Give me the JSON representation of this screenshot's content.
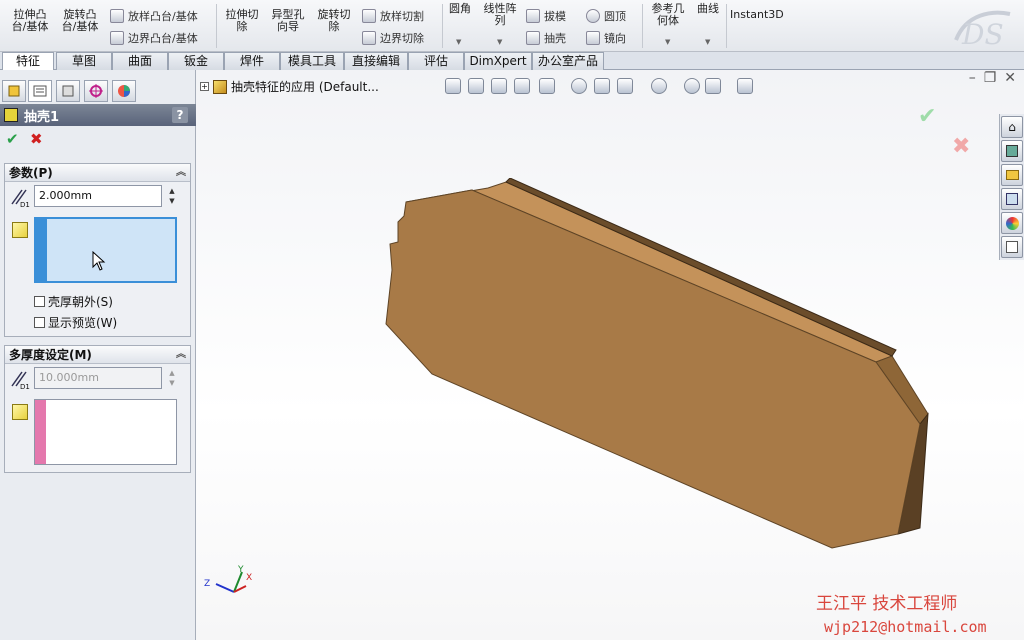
{
  "ribbon": {
    "btn_extrude_boss": "拉伸凸\n台/基体",
    "btn_revolve_boss": "旋转凸\n台/基体",
    "btn_loft_boss": "放样凸台/基体",
    "btn_boundary_boss": "边界凸台/基体",
    "btn_extrude_cut": "拉伸切\n除",
    "btn_hole_wizard": "异型孔\n向导",
    "btn_revolve_cut": "旋转切\n除",
    "btn_loft_cut": "放样切割",
    "btn_boundary_cut": "边界切除",
    "btn_fillet": "圆角",
    "btn_linear_pattern": "线性阵\n列",
    "btn_draft": "拔模",
    "btn_shell": "抽壳",
    "btn_dome": "圆顶",
    "btn_mirror": "镜向",
    "btn_ref_geometry": "参考几\n何体",
    "btn_curves": "曲线",
    "btn_instant3d": "Instant3D"
  },
  "tabs": [
    "特征",
    "草图",
    "曲面",
    "钣金",
    "焊件",
    "模具工具",
    "直接编辑",
    "评估",
    "DimXpert",
    "办公室产品"
  ],
  "active_tab": "特征",
  "feature": {
    "title": "抽壳1",
    "help": "?",
    "ok": "✔",
    "cancel": "✖"
  },
  "params": {
    "title": "参数(P)",
    "thickness": "2.000mm",
    "dim_label": "D1",
    "shell_outward": "壳厚朝外(S)",
    "show_preview": "显示预览(W)"
  },
  "multi": {
    "title": "多厚度设定(M)",
    "thickness": "10.000mm",
    "dim_label": "D1"
  },
  "viewport": {
    "breadcrumb": "抽壳特征的应用  (Default...",
    "confirm_ok": "✔",
    "confirm_cancel": "✖",
    "triad_x": "X",
    "triad_y": "Y",
    "triad_z": "Z"
  },
  "watermark": {
    "name": "王江平     技术工程师",
    "email": "wjp212@hotmail.com"
  },
  "colors": {
    "part_face": "#a87a47",
    "part_edge": "#5e4426",
    "accent_blue": "#3a8fd8",
    "accent_pink": "#e478ad",
    "watermark": "#d9463d"
  }
}
